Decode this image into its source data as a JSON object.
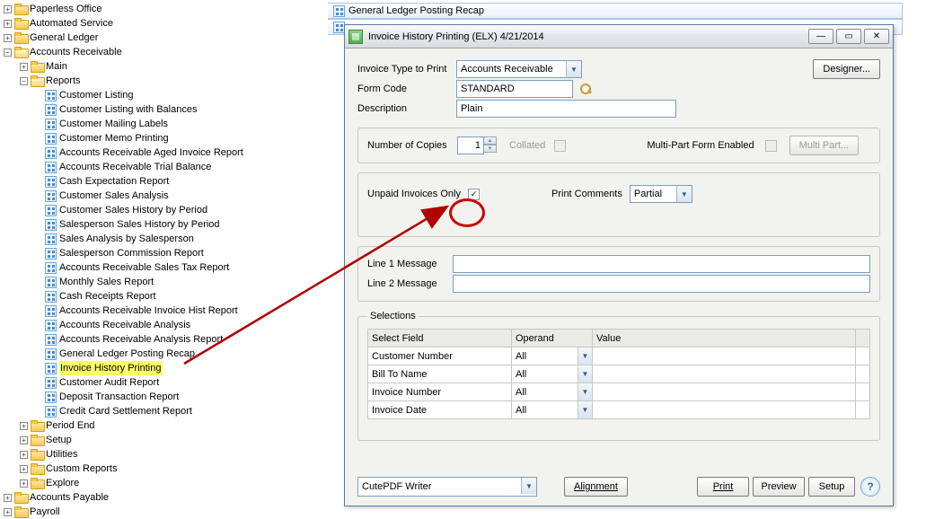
{
  "tree": {
    "paperless": "Paperless Office",
    "automated": "Automated Service",
    "gl": "General Ledger",
    "ar": "Accounts Receivable",
    "main": "Main",
    "reports": "Reports",
    "r": [
      "Customer Listing",
      "Customer Listing with Balances",
      "Customer Mailing Labels",
      "Customer Memo Printing",
      "Accounts Receivable Aged Invoice Report",
      "Accounts Receivable Trial Balance",
      "Cash Expectation Report",
      "Customer Sales Analysis",
      "Customer Sales History by Period",
      "Salesperson Sales History by Period",
      "Sales Analysis by Salesperson",
      "Salesperson Commission Report",
      "Accounts Receivable Sales Tax Report",
      "Monthly Sales Report",
      "Cash Receipts Report",
      "Accounts Receivable Invoice Hist Report",
      "Accounts Receivable Analysis",
      "Accounts Receivable Analysis Report",
      "General Ledger Posting Recap",
      "Invoice History Printing",
      "Customer Audit Report",
      "Deposit Transaction Report",
      "Credit Card Settlement Report"
    ],
    "period_end": "Period End",
    "setup": "Setup",
    "utilities": "Utilities",
    "custom": "Custom Reports",
    "explore": "Explore",
    "ap": "Accounts Payable",
    "payroll": "Payroll"
  },
  "bgTab": "General Ledger Posting Recap",
  "dialog": {
    "title": "Invoice History Printing (ELX) 4/21/2014",
    "invoice_type_label": "Invoice Type to Print",
    "invoice_type_value": "Accounts Receivable",
    "form_code_label": "Form Code",
    "form_code_value": "STANDARD",
    "description_label": "Description",
    "description_value": "Plain",
    "designer": "Designer...",
    "copies_label": "Number of Copies",
    "copies_value": "1",
    "collated": "Collated",
    "multipart_label": "Multi-Part Form Enabled",
    "multipart_btn": "Multi Part...",
    "unpaid_label": "Unpaid Invoices Only",
    "print_comments_label": "Print Comments",
    "print_comments_value": "Partial",
    "line1": "Line 1 Message",
    "line2": "Line 2 Message",
    "selections": "Selections",
    "th_field": "Select Field",
    "th_operand": "Operand",
    "th_value": "Value",
    "rows": [
      {
        "field": "Customer Number",
        "op": "All"
      },
      {
        "field": "Bill To Name",
        "op": "All"
      },
      {
        "field": "Invoice Number",
        "op": "All"
      },
      {
        "field": "Invoice Date",
        "op": "All"
      }
    ],
    "printer": "CutePDF Writer",
    "alignment": "Alignment",
    "print": "Print",
    "preview": "Preview",
    "setup_btn": "Setup"
  }
}
